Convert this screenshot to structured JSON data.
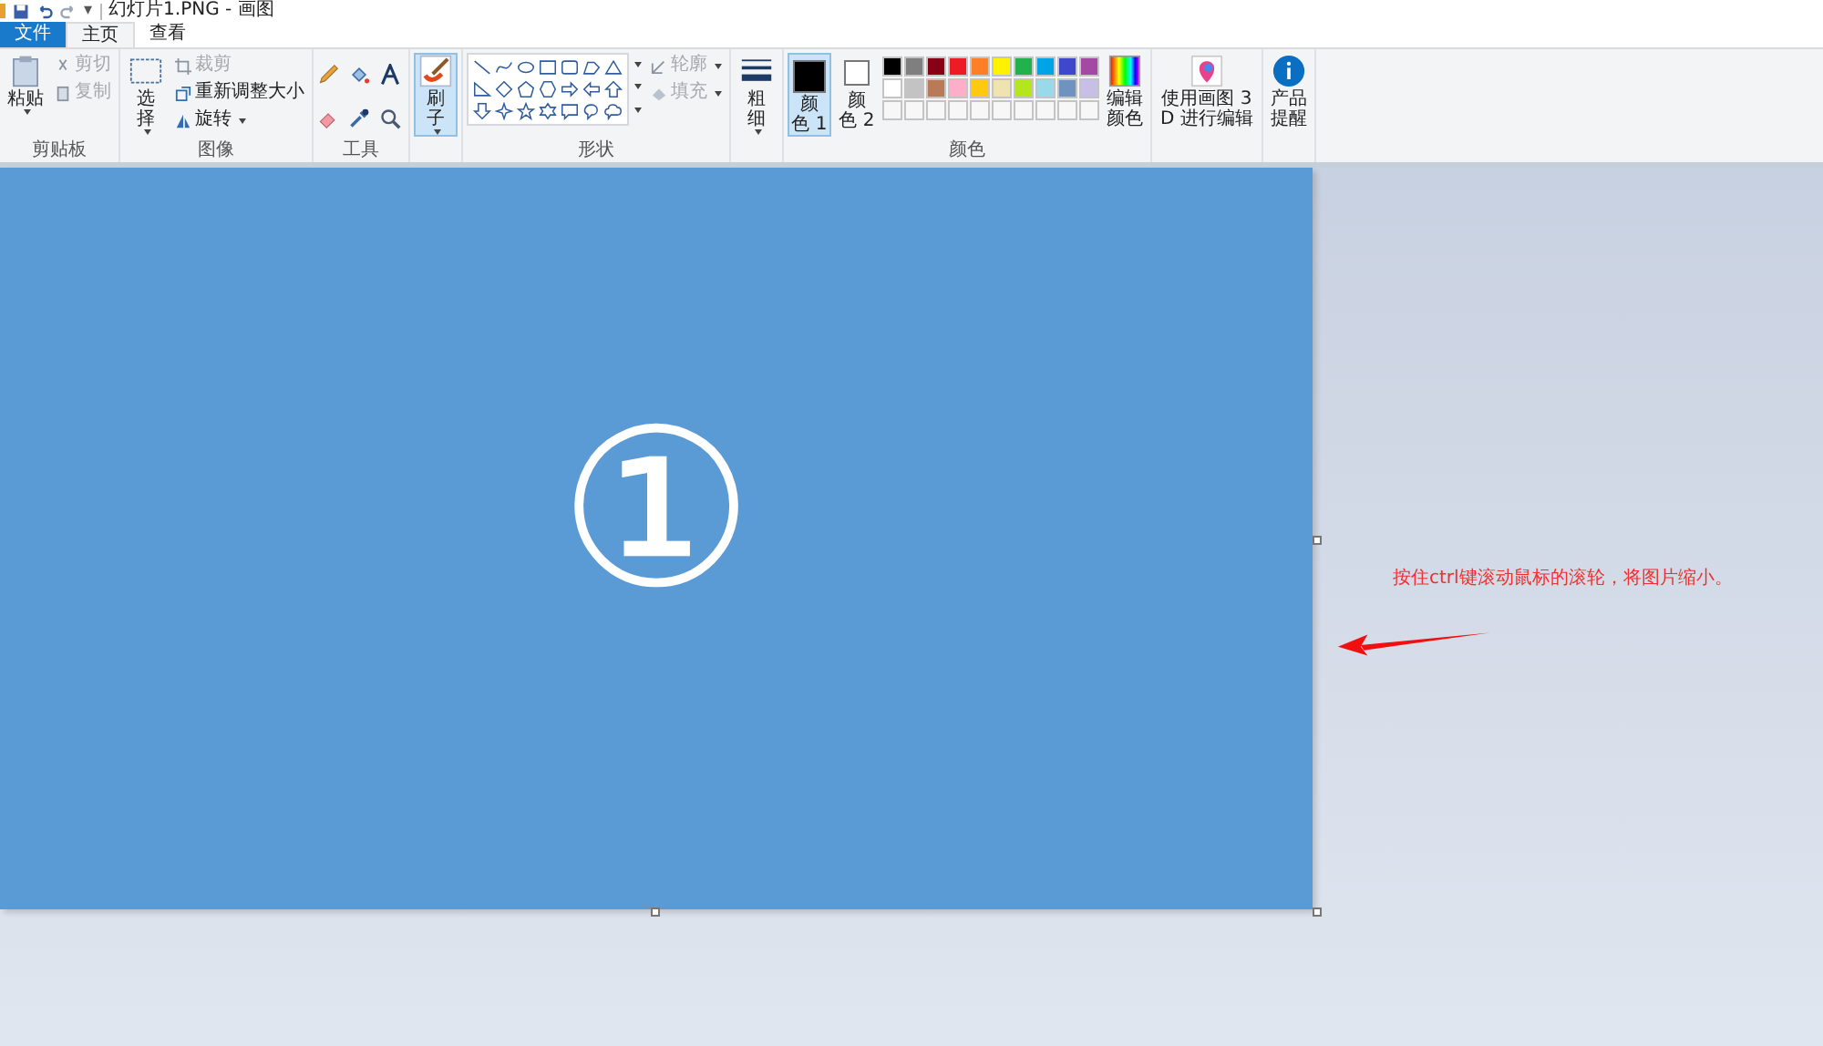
{
  "window": {
    "title": "幻灯片1.PNG - 画图",
    "menu_glyph": "▾"
  },
  "tabs": [
    {
      "label": "文件",
      "selected": false,
      "kind": "file"
    },
    {
      "label": "主页",
      "selected": true,
      "kind": "tab"
    },
    {
      "label": "查看",
      "selected": false,
      "kind": "tab"
    }
  ],
  "ribbon": {
    "clipboard": {
      "label": "剪贴板",
      "paste": "粘贴",
      "small": [
        {
          "label": "剪切",
          "disabled": true,
          "kind": "cut"
        },
        {
          "label": "复制",
          "disabled": true,
          "kind": "copy"
        }
      ]
    },
    "image": {
      "label": "图像",
      "select": "选择",
      "small": [
        {
          "label": "裁剪",
          "disabled": true,
          "kind": "crop"
        },
        {
          "label": "重新调整大小",
          "disabled": false,
          "kind": "resize"
        },
        {
          "label": "旋转",
          "disabled": false,
          "kind": "rotate"
        }
      ]
    },
    "tools": {
      "label": "工具"
    },
    "brushes": {
      "label": "刷子",
      "selected": true
    },
    "shapes": {
      "label": "形状",
      "options": [
        {
          "label": "轮廓",
          "disabled": true,
          "kind": "outline"
        },
        {
          "label": "填充",
          "disabled": true,
          "kind": "fill"
        }
      ]
    },
    "size": {
      "label": "粗细"
    },
    "colors": {
      "label": "颜色",
      "slots": [
        {
          "label": "颜色 1",
          "color": "#000000",
          "selected": true
        },
        {
          "label": "颜色 2",
          "color": "#ffffff",
          "selected": false
        }
      ],
      "swatches": [
        {
          "color": "#000000"
        },
        {
          "color": "#7f7f7f"
        },
        {
          "color": "#880015"
        },
        {
          "color": "#ed1c24"
        },
        {
          "color": "#ff7f27"
        },
        {
          "color": "#fff200"
        },
        {
          "color": "#22b14c"
        },
        {
          "color": "#00a2e8"
        },
        {
          "color": "#3f48cc"
        },
        {
          "color": "#a349a4"
        },
        {
          "color": "#ffffff"
        },
        {
          "color": "#c3c3c3"
        },
        {
          "color": "#b97a57"
        },
        {
          "color": "#ffaec9"
        },
        {
          "color": "#ffc90e"
        },
        {
          "color": "#efe4b0"
        },
        {
          "color": "#b5e61d"
        },
        {
          "color": "#99d9ea"
        },
        {
          "color": "#7092be"
        },
        {
          "color": "#c8bfe7"
        }
      ],
      "edit": "编辑颜色"
    },
    "paint3d": "使用画图 3D 进行编辑",
    "notify": "产品提醒"
  },
  "canvas": {
    "symbol": "①"
  },
  "annotation": {
    "text": "按住ctrl键滚动鼠标的滚轮，将图片缩小。"
  }
}
